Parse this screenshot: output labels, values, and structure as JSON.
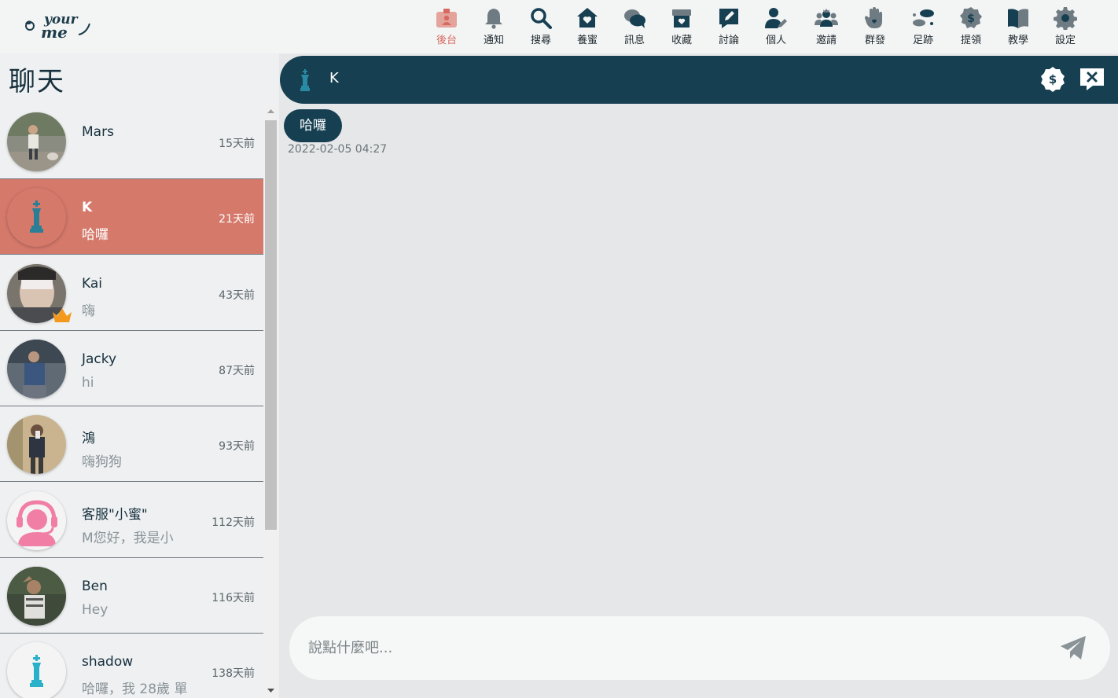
{
  "nav": [
    {
      "label": "後台",
      "icon": "badge-icon",
      "active": true
    },
    {
      "label": "通知",
      "icon": "bell-icon"
    },
    {
      "label": "搜尋",
      "icon": "search-icon"
    },
    {
      "label": "養蜜",
      "icon": "home-heart-icon"
    },
    {
      "label": "訊息",
      "icon": "chat-bubbles-icon"
    },
    {
      "label": "收藏",
      "icon": "box-heart-icon"
    },
    {
      "label": "討論",
      "icon": "pencil-note-icon"
    },
    {
      "label": "個人",
      "icon": "user-edit-icon"
    },
    {
      "label": "邀請",
      "icon": "users-group-icon"
    },
    {
      "label": "群發",
      "icon": "hand-icon"
    },
    {
      "label": "足跡",
      "icon": "footprints-icon"
    },
    {
      "label": "提領",
      "icon": "dollar-badge-icon"
    },
    {
      "label": "教學",
      "icon": "book-icon"
    },
    {
      "label": "設定",
      "icon": "gear-icon"
    }
  ],
  "sidebar": {
    "title": "聊天",
    "conversations": [
      {
        "name": "Mars",
        "preview": "",
        "time": "15天前"
      },
      {
        "name": "K",
        "preview": "哈囉",
        "time": "21天前",
        "active": true
      },
      {
        "name": "Kai",
        "preview": "嗨",
        "time": "43天前"
      },
      {
        "name": "Jacky",
        "preview": "hi",
        "time": "87天前"
      },
      {
        "name": "鴻",
        "preview": "嗨狗狗",
        "time": "93天前"
      },
      {
        "name": "客服\"小蜜\"",
        "preview": "M您好，我是小",
        "time": "112天前"
      },
      {
        "name": "Ben",
        "preview": "Hey",
        "time": "116天前"
      },
      {
        "name": "shadow",
        "preview": "哈囉，我 28歲 單",
        "time": "138天前"
      }
    ]
  },
  "chat": {
    "partner_name": "K",
    "messages": [
      {
        "text": "哈囉",
        "time": "2022-02-05 04:27"
      }
    ],
    "input_placeholder": "說點什麼吧..."
  },
  "colors": {
    "header_bg": "#163f52",
    "active_row": "#d5796b",
    "accent_active_nav": "#d66a60"
  }
}
